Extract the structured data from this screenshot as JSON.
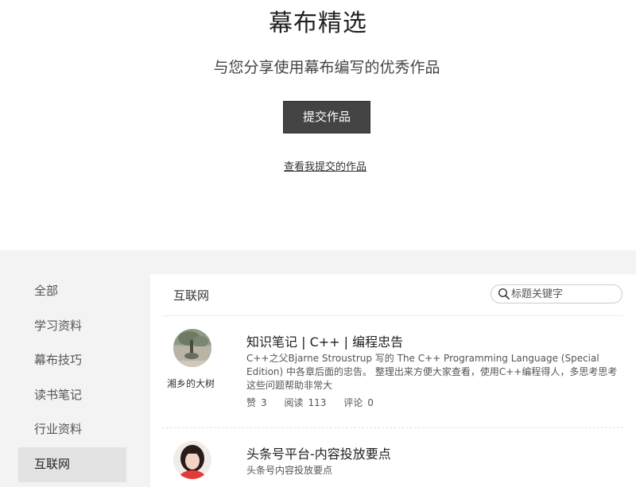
{
  "hero": {
    "title": "幕布精选",
    "subtitle": "与您分享使用幕布编写的优秀作品",
    "submit_label": "提交作品",
    "my_works_link": "查看我提交的作品"
  },
  "sidebar": {
    "items": [
      {
        "label": "全部",
        "active": false
      },
      {
        "label": "学习资料",
        "active": false
      },
      {
        "label": "幕布技巧",
        "active": false
      },
      {
        "label": "读书笔记",
        "active": false
      },
      {
        "label": "行业资料",
        "active": false
      },
      {
        "label": "互联网",
        "active": true
      }
    ]
  },
  "panel": {
    "title": "互联网",
    "search": {
      "placeholder": "标题关键字",
      "value": ""
    }
  },
  "articles": [
    {
      "author": "湘乡的大树",
      "title": "知识笔记 | C++ | 编程忠告",
      "description": "C++之父Bjarne Stroustrup 写的 The C++ Programming Language (Special Edition) 中各章后面的忠告。 整理出来方便大家查看，使用C++编程得人，多思考思考这些问题帮助非常大",
      "likes_label": "赞",
      "likes": "3",
      "views_label": "阅读",
      "views": "113",
      "comments_label": "评论",
      "comments": "0"
    },
    {
      "author": "",
      "title": "头条号平台-内容投放要点",
      "description": "头条号内容投放要点"
    }
  ],
  "colors": {
    "button_bg": "#444444",
    "lower_bg": "#f3f3f3",
    "active_item_bg": "#e3e3e3"
  },
  "icons": {
    "search": "search-icon"
  }
}
